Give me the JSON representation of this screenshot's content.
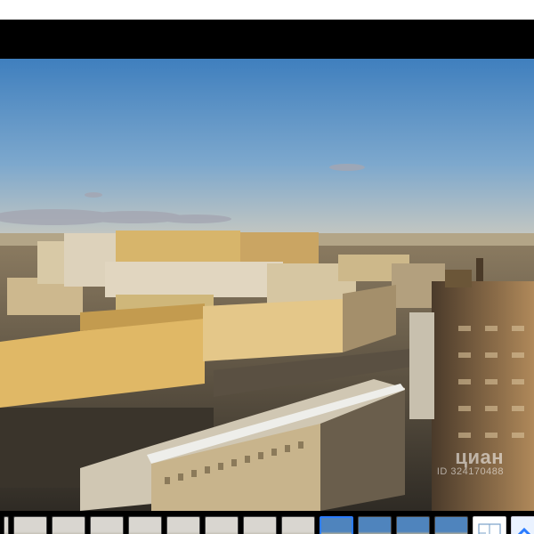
{
  "viewer": {
    "watermark_brand": "циан",
    "watermark_id": "ID 324170488"
  },
  "thumbnails": [
    {
      "name": "thumb-interior-partial",
      "kind": "interior"
    },
    {
      "name": "thumb-interior-1",
      "kind": "interior"
    },
    {
      "name": "thumb-interior-2",
      "kind": "interior"
    },
    {
      "name": "thumb-interior-3",
      "kind": "interior"
    },
    {
      "name": "thumb-interior-4",
      "kind": "interior"
    },
    {
      "name": "thumb-interior-5",
      "kind": "interior"
    },
    {
      "name": "thumb-interior-6",
      "kind": "interior"
    },
    {
      "name": "thumb-interior-7",
      "kind": "interior"
    },
    {
      "name": "thumb-interior-8",
      "kind": "interior"
    },
    {
      "name": "thumb-view-active",
      "kind": "view",
      "selected": true
    },
    {
      "name": "thumb-view-2",
      "kind": "view"
    },
    {
      "name": "thumb-view-3",
      "kind": "view"
    },
    {
      "name": "thumb-view-4",
      "kind": "view"
    },
    {
      "name": "thumb-floor-plan",
      "kind": "plan"
    },
    {
      "name": "thumb-more",
      "kind": "more"
    }
  ],
  "colors": {
    "sky_top": "#4a86c0",
    "sky_bottom": "#c7c8c0",
    "selected_border": "#2b7cff",
    "building_warm": "#e3c27a"
  }
}
